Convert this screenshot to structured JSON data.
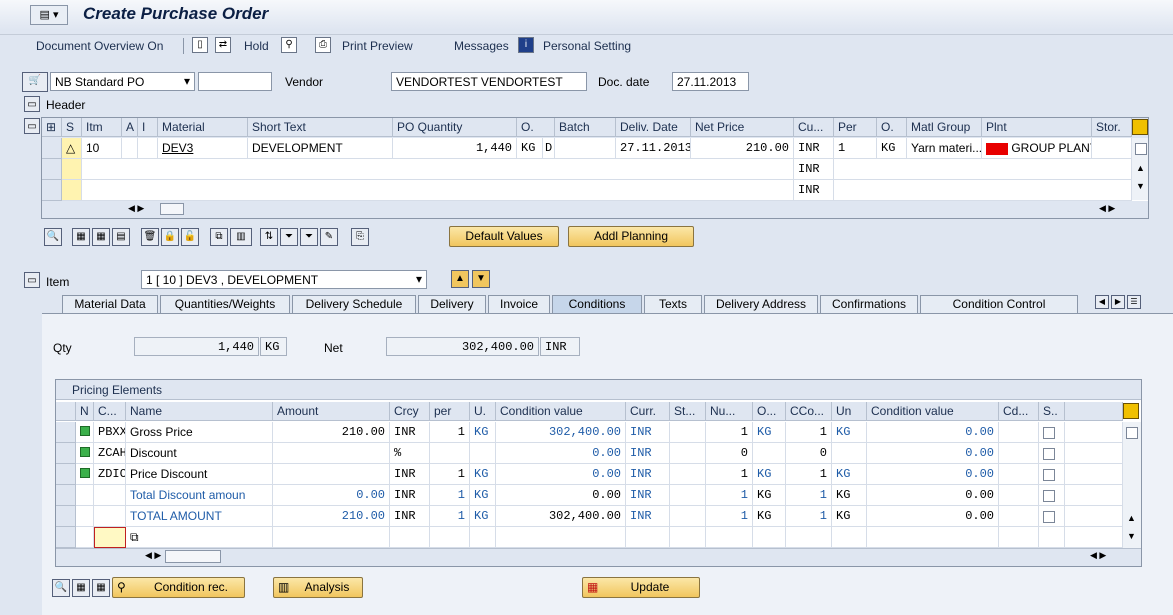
{
  "window": {
    "title": "Create Purchase Order"
  },
  "toolbar": {
    "doc_overview": "Document Overview On",
    "hold": "Hold",
    "print_preview": "Print Preview",
    "messages": "Messages",
    "personal_setting": "Personal Setting"
  },
  "header_bar": {
    "doc_type": "NB Standard PO",
    "vendor_label": "Vendor",
    "vendor_value": "VENDORTEST VENDORTEST",
    "doc_date_label": "Doc. date",
    "doc_date_value": "27.11.2013",
    "header_label": "Header"
  },
  "items_table": {
    "columns": [
      "S",
      "Itm",
      "A",
      "I",
      "Material",
      "Short Text",
      "PO Quantity",
      "O.",
      "Batch",
      "Deliv. Date",
      "Net Price",
      "Cu...",
      "Per",
      "O.",
      "Matl Group",
      "Plnt",
      "Stor."
    ],
    "rows": [
      {
        "itm": "10",
        "material": "DEV3",
        "short_text": "DEVELOPMENT",
        "qty": "1,440",
        "uom": "KG",
        "o": "D",
        "date": "27.11.2013",
        "price": "210.00",
        "cur": "INR",
        "per": "1",
        "o2": "KG",
        "matl_group": "Yarn materi...",
        "plant": "GROUP PLANT"
      },
      {
        "cur": "INR"
      },
      {
        "cur": "INR"
      }
    ]
  },
  "buttons": {
    "default_values": "Default Values",
    "addl_planning": "Addl Planning",
    "condition_rec": "Condition rec.",
    "analysis": "Analysis",
    "update": "Update"
  },
  "item_section": {
    "label": "Item",
    "selector": "1 [ 10 ] DEV3 , DEVELOPMENT"
  },
  "tabs": [
    "Material Data",
    "Quantities/Weights",
    "Delivery Schedule",
    "Delivery",
    "Invoice",
    "Conditions",
    "Texts",
    "Delivery Address",
    "Confirmations",
    "Condition Control"
  ],
  "conditions": {
    "qty_label": "Qty",
    "qty_value": "1,440",
    "qty_unit": "KG",
    "net_label": "Net",
    "net_value": "302,400.00",
    "net_currency": "INR",
    "pricing_title": "Pricing Elements",
    "columns": [
      "N",
      "C...",
      "Name",
      "Amount",
      "Crcy",
      "per",
      "U.",
      "Condition value",
      "Curr.",
      "St...",
      "Nu...",
      "O...",
      "CCo...",
      "Un",
      "Condition value",
      "Cd...",
      "S.."
    ],
    "rows": [
      {
        "type": "PBXX",
        "name": "Gross Price",
        "amount": "210.00",
        "crcy": "INR",
        "per": "1",
        "u": "KG",
        "cond_value": "302,400.00",
        "curr": "INR",
        "nu": "1",
        "o": "KG",
        "cco": "1",
        "un": "KG",
        "cond_value2": "0.00",
        "light": true
      },
      {
        "type": "ZCAH",
        "name": "Discount",
        "amount": "",
        "crcy": "%",
        "per": "",
        "u": "",
        "cond_value": "0.00",
        "curr": "INR",
        "nu": "0",
        "o": "",
        "cco": "0",
        "un": "",
        "cond_value2": "0.00",
        "light": true
      },
      {
        "type": "ZDIC",
        "name": "Price Discount",
        "amount": "",
        "crcy": "INR",
        "per": "1",
        "u": "KG",
        "cond_value": "0.00",
        "curr": "INR",
        "nu": "1",
        "o": "KG",
        "cco": "1",
        "un": "KG",
        "cond_value2": "0.00",
        "light": true
      },
      {
        "type": "",
        "name": "Total Discount amoun",
        "amount": "0.00",
        "crcy": "INR",
        "per": "1",
        "u": "KG",
        "cond_value": "0.00",
        "curr": "INR",
        "nu": "1",
        "o": "KG",
        "cco": "1",
        "un": "KG",
        "cond_value2": "0.00",
        "light": false
      },
      {
        "type": "",
        "name": "TOTAL AMOUNT",
        "amount": "210.00",
        "crcy": "INR",
        "per": "1",
        "u": "KG",
        "cond_value": "302,400.00",
        "curr": "INR",
        "nu": "1",
        "o": "KG",
        "cco": "1",
        "un": "KG",
        "cond_value2": "0.00",
        "light": false
      }
    ]
  }
}
